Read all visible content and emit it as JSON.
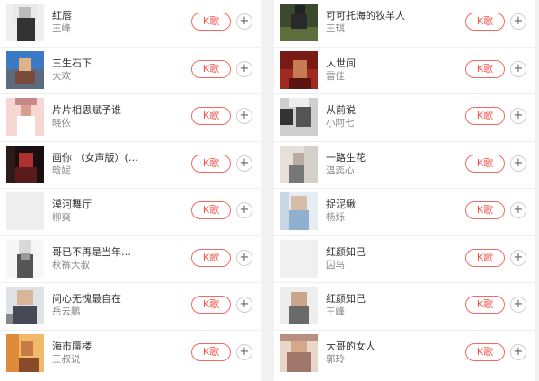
{
  "left_songs": [
    {
      "title": "红唇",
      "artist": "王峰"
    },
    {
      "title": "三生石下",
      "artist": "大欢"
    },
    {
      "title": "片片相思赋予谁",
      "artist": "晓依"
    },
    {
      "title": "画你 （女声版）(…",
      "artist": "晗妮"
    },
    {
      "title": "漠河舞厅",
      "artist": "柳爽"
    },
    {
      "title": "哥已不再是当年…",
      "artist": "秋裤大叔"
    },
    {
      "title": "问心无愧最自在",
      "artist": "岳云鹏"
    },
    {
      "title": "海市蜃楼",
      "artist": "三叔说"
    }
  ],
  "right_songs": [
    {
      "title": "可可托海的牧羊人",
      "artist": "王琪"
    },
    {
      "title": "人世间",
      "artist": "雷佳"
    },
    {
      "title": "从前说",
      "artist": "小阿七"
    },
    {
      "title": "一路生花",
      "artist": "温奕心"
    },
    {
      "title": "捉泥鳅",
      "artist": "杨烁"
    },
    {
      "title": "红颜知己",
      "artist": "囚鸟"
    },
    {
      "title": "红颜知己",
      "artist": "王峰"
    },
    {
      "title": "大哥的女人",
      "artist": "郭玲"
    }
  ],
  "karaoke_label": "K歌",
  "add_label": "+",
  "icons": {
    "add": "plus-circle-icon"
  },
  "colors": {
    "accent": "#f2564d",
    "title": "#333333",
    "artist": "#888888"
  }
}
